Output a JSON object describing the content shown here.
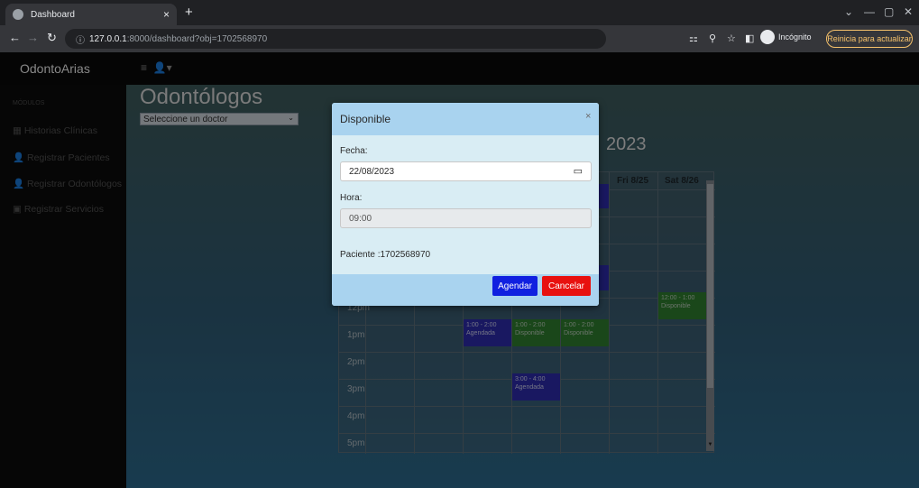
{
  "browser": {
    "tab_title": "Dashboard",
    "tab_close": "×",
    "new_tab": "+",
    "url_host": "127.0.0.1",
    "url_rest": ":8000/dashboard?obj=1702568970",
    "incognito_label": "Incógnito",
    "update_button": "Reinicia para actualizar",
    "window_minimize": "—",
    "window_restore": "▢",
    "window_close": "✕"
  },
  "app": {
    "brand": "OdontoArias",
    "sidebar": {
      "header": "MÓDULOS",
      "items": [
        {
          "label": "Historias Clínicas",
          "icon": "grid-icon"
        },
        {
          "label": "Registrar Pacientes",
          "icon": "user-plus-icon"
        },
        {
          "label": "Registrar Odontólogos",
          "icon": "user-plus-icon"
        },
        {
          "label": "Registrar Servicios",
          "icon": "service-icon"
        }
      ]
    },
    "page_title": "Odontólogos",
    "doctor_select": {
      "value": "Seleccione un doctor"
    },
    "calendar": {
      "title_fragment": "2023",
      "visible_headers": [
        "Fri 8/25",
        "Sat 8/26"
      ],
      "hours": [
        "12pm",
        "1pm",
        "2pm",
        "3pm",
        "4pm",
        "5pm"
      ],
      "events": [
        {
          "time": "1:00 - 2:00",
          "status": "Agendada",
          "kind": "agendada"
        },
        {
          "time": "1:00 - 2:00",
          "status": "Disponible",
          "kind": "disponible"
        },
        {
          "time": "1:00 - 2:00",
          "status": "Disponible",
          "kind": "disponible"
        },
        {
          "time": "12:00 - 1:00",
          "status": "Disponible",
          "kind": "disponible"
        },
        {
          "time": "3:00 - 4:00",
          "status": "Agendada",
          "kind": "agendada"
        }
      ]
    }
  },
  "modal": {
    "title": "Disponible",
    "close": "×",
    "fecha_label": "Fecha:",
    "fecha_value": "22/08/2023",
    "hora_label": "Hora:",
    "hora_value": "09:00",
    "paciente": "Paciente :1702568970",
    "agendar": "Agendar",
    "cancelar": "Cancelar"
  },
  "colors": {
    "agendada": "#2b2aa8",
    "disponible": "#2e7a2e",
    "agendar_button": "#1020e0",
    "cancelar_button": "#e8110f",
    "modal_header": "#a9d3ef"
  }
}
